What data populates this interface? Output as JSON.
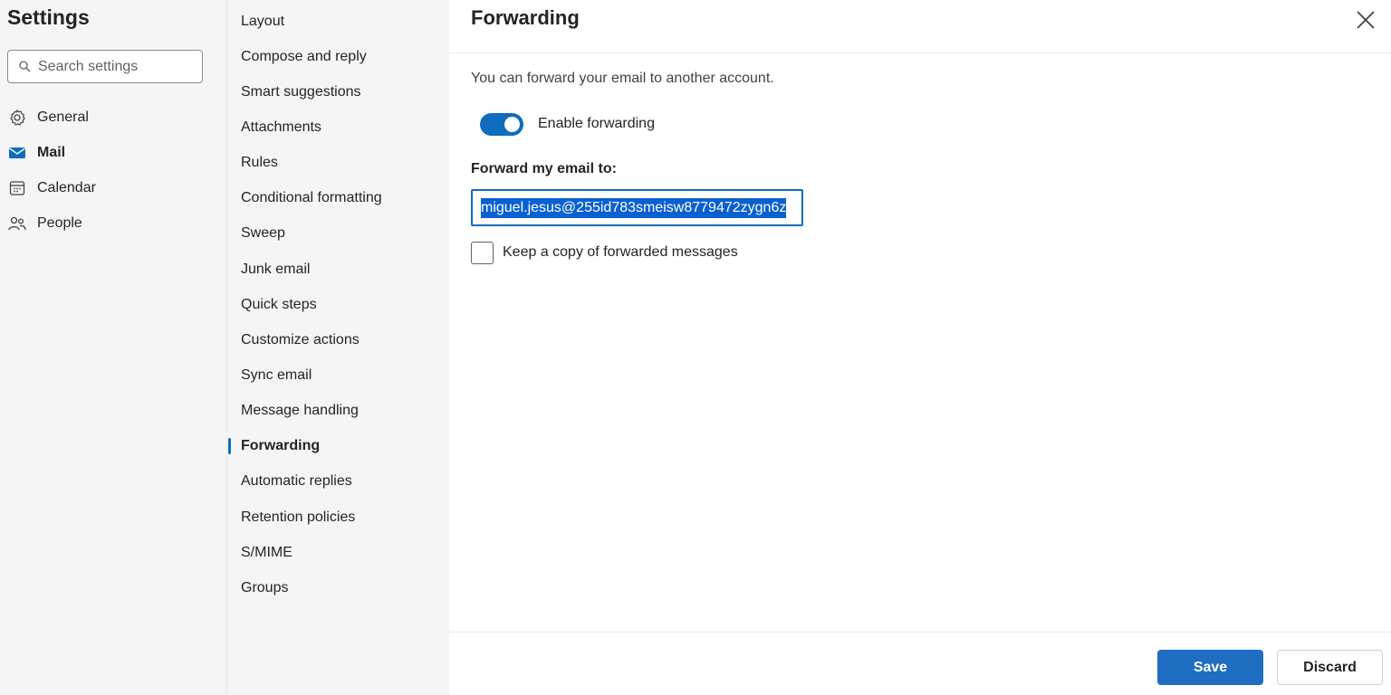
{
  "settings": {
    "title": "Settings",
    "search_placeholder": "Search settings",
    "nav": [
      {
        "label": "General",
        "icon": "gear-icon",
        "active": false
      },
      {
        "label": "Mail",
        "icon": "mail-icon",
        "active": true
      },
      {
        "label": "Calendar",
        "icon": "calendar-icon",
        "active": false
      },
      {
        "label": "People",
        "icon": "people-icon",
        "active": false
      }
    ]
  },
  "mail_menu": {
    "items": [
      "Layout",
      "Compose and reply",
      "Smart suggestions",
      "Attachments",
      "Rules",
      "Conditional formatting",
      "Sweep",
      "Junk email",
      "Quick steps",
      "Customize actions",
      "Sync email",
      "Message handling",
      "Forwarding",
      "Automatic replies",
      "Retention policies",
      "S/MIME",
      "Groups"
    ],
    "active": "Forwarding"
  },
  "forwarding": {
    "title": "Forwarding",
    "description": "You can forward your email to another account.",
    "enable_label": "Enable forwarding",
    "enabled": true,
    "forward_label": "Forward my email to:",
    "email_value": "miguel.jesus@255id783smeisw8779472zygn6z",
    "keep_copy_label": "Keep a copy of forwarded messages",
    "keep_copy": false
  },
  "footer": {
    "save_label": "Save",
    "discard_label": "Discard"
  },
  "colors": {
    "accent": "#0f6cbd",
    "save_button": "#1f6ec2",
    "selection": "#0a60d0"
  }
}
